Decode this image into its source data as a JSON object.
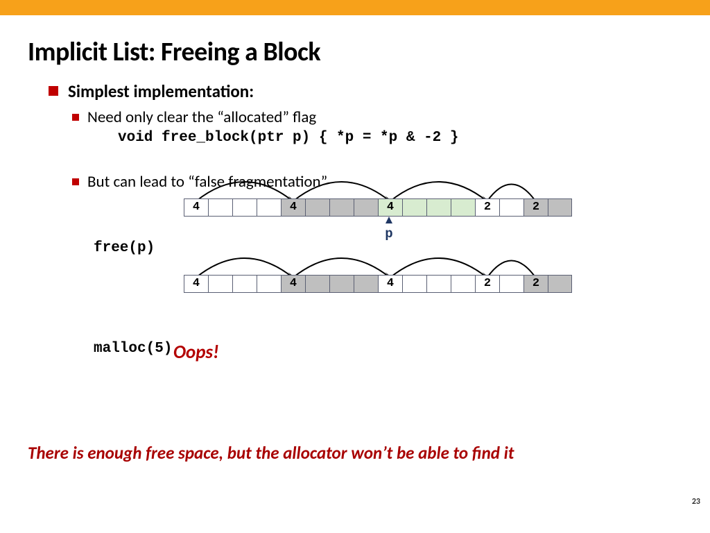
{
  "title": "Implicit List: Freeing a Block",
  "bullets": {
    "main": "Simplest implementation:",
    "sub1": "Need only clear the “allocated” flag",
    "code": "void free_block(ptr p) { *p = *p & -2 }",
    "sub2": "But can lead to “false fragmentation”"
  },
  "diagram": {
    "row1": [
      {
        "v": "4",
        "c": "w"
      },
      {
        "v": "",
        "c": "w"
      },
      {
        "v": "",
        "c": "w"
      },
      {
        "v": "",
        "c": "w"
      },
      {
        "v": "4",
        "c": "g"
      },
      {
        "v": "",
        "c": "g"
      },
      {
        "v": "",
        "c": "g"
      },
      {
        "v": "",
        "c": "g"
      },
      {
        "v": "4",
        "c": "gr"
      },
      {
        "v": "",
        "c": "gr"
      },
      {
        "v": "",
        "c": "gr"
      },
      {
        "v": "",
        "c": "gr"
      },
      {
        "v": "2",
        "c": "w"
      },
      {
        "v": "",
        "c": "w"
      },
      {
        "v": "2",
        "c": "g"
      },
      {
        "v": "",
        "c": "g"
      }
    ],
    "row2": [
      {
        "v": "4",
        "c": "w"
      },
      {
        "v": "",
        "c": "w"
      },
      {
        "v": "",
        "c": "w"
      },
      {
        "v": "",
        "c": "w"
      },
      {
        "v": "4",
        "c": "g"
      },
      {
        "v": "",
        "c": "g"
      },
      {
        "v": "",
        "c": "g"
      },
      {
        "v": "",
        "c": "g"
      },
      {
        "v": "4",
        "c": "w"
      },
      {
        "v": "",
        "c": "w"
      },
      {
        "v": "",
        "c": "w"
      },
      {
        "v": "",
        "c": "w"
      },
      {
        "v": "2",
        "c": "w"
      },
      {
        "v": "",
        "c": "w"
      },
      {
        "v": "2",
        "c": "g"
      },
      {
        "v": "",
        "c": "g"
      }
    ],
    "arcs": [
      {
        "from": 0,
        "to": 4
      },
      {
        "from": 4,
        "to": 8
      },
      {
        "from": 8,
        "to": 12
      },
      {
        "from": 12,
        "to": 14
      }
    ],
    "pointer_label": "p",
    "free_label": "free(p)",
    "malloc_label": "malloc(5)",
    "oops": "Oops!"
  },
  "callout": "There is enough free space, but the allocator won’t be able to find it",
  "page": "23"
}
